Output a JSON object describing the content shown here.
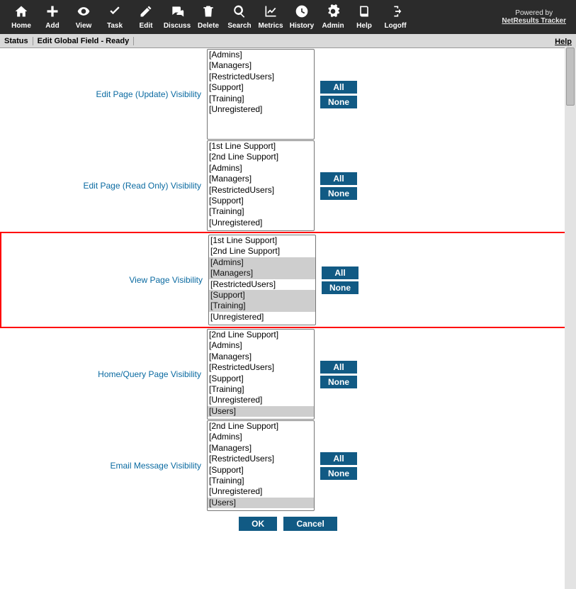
{
  "branding": {
    "powered_by": "Powered by",
    "product": "NetResults Tracker"
  },
  "toolbar": {
    "items": [
      {
        "label": "Home",
        "icon": "home"
      },
      {
        "label": "Add",
        "icon": "plus"
      },
      {
        "label": "View",
        "icon": "eye"
      },
      {
        "label": "Task",
        "icon": "check"
      },
      {
        "label": "Edit",
        "icon": "pencil"
      },
      {
        "label": "Discuss",
        "icon": "comments"
      },
      {
        "label": "Delete",
        "icon": "trash"
      },
      {
        "label": "Search",
        "icon": "search"
      },
      {
        "label": "Metrics",
        "icon": "chart"
      },
      {
        "label": "History",
        "icon": "clock"
      },
      {
        "label": "Admin",
        "icon": "gear"
      },
      {
        "label": "Help",
        "icon": "book"
      },
      {
        "label": "Logoff",
        "icon": "logoff"
      }
    ]
  },
  "statusbar": {
    "status_label": "Status",
    "status_text": "Edit Global Field - Ready",
    "help": "Help"
  },
  "groups": {
    "set_a": [
      "[Admins]",
      "[Managers]",
      "[RestrictedUsers]",
      "[Support]",
      "[Training]",
      "[Unregistered]"
    ],
    "set_b": [
      "[1st Line Support]",
      "[2nd Line Support]",
      "[Admins]",
      "[Managers]",
      "[RestrictedUsers]",
      "[Support]",
      "[Training]",
      "[Unregistered]"
    ],
    "set_c": [
      "[2nd Line Support]",
      "[Admins]",
      "[Managers]",
      "[RestrictedUsers]",
      "[Support]",
      "[Training]",
      "[Unregistered]",
      "[Users]"
    ]
  },
  "rows": [
    {
      "key": "edit_update",
      "label": "Edit Page (Update) Visibility",
      "options": "set_a",
      "selected": [],
      "highlighted": false
    },
    {
      "key": "edit_readonly",
      "label": "Edit Page (Read Only) Visibility",
      "options": "set_b",
      "selected": [],
      "highlighted": false
    },
    {
      "key": "view_page",
      "label": "View Page Visibility",
      "options": "set_b",
      "selected": [
        "[Admins]",
        "[Managers]",
        "[Support]",
        "[Training]"
      ],
      "highlighted": true
    },
    {
      "key": "home_query",
      "label": "Home/Query Page Visibility",
      "options": "set_c",
      "selected": [
        "[Users]"
      ],
      "highlighted": false
    },
    {
      "key": "email",
      "label": "Email Message Visibility",
      "options": "set_c",
      "selected": [
        "[Users]"
      ],
      "highlighted": false
    }
  ],
  "buttons": {
    "all": "All",
    "none": "None",
    "ok": "OK",
    "cancel": "Cancel"
  }
}
